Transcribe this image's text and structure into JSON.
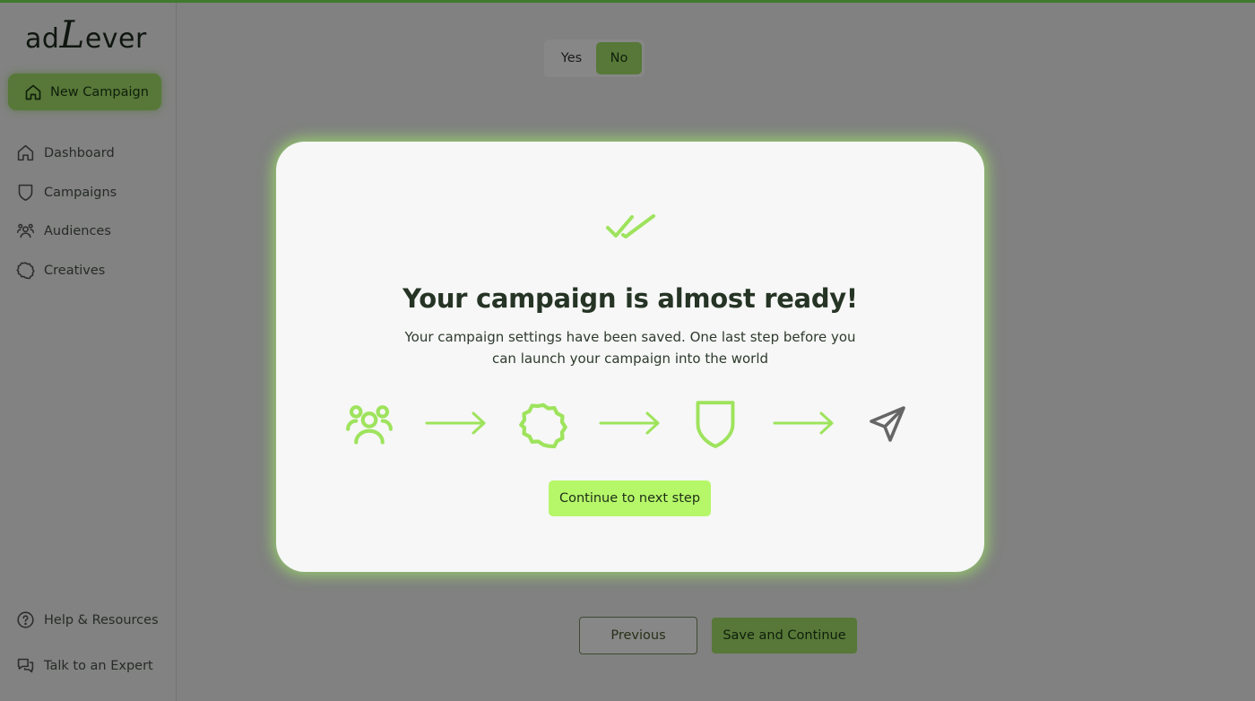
{
  "app": {
    "logo_prefix": "ad",
    "logo_letter": "L",
    "logo_suffix": "ever"
  },
  "sidebar": {
    "new_campaign_label": "New Campaign",
    "items": [
      {
        "label": "Dashboard",
        "icon": "home-icon"
      },
      {
        "label": "Campaigns",
        "icon": "shield-icon"
      },
      {
        "label": "Audiences",
        "icon": "users-icon"
      },
      {
        "label": "Creatives",
        "icon": "badge-icon"
      }
    ],
    "footer_items": [
      {
        "label": "Help & Resources",
        "icon": "help-circle-icon"
      },
      {
        "label": "Talk to an Expert",
        "icon": "chat-bubbles-icon"
      }
    ]
  },
  "main": {
    "yes_label": "Yes",
    "no_label": "No",
    "selected": "No",
    "previous_label": "Previous",
    "save_continue_label": "Save and Continue"
  },
  "modal": {
    "title": "Your campaign is almost ready!",
    "description": "Your campaign settings have been saved. One last step before you can launch your campaign into the world",
    "cta_label": "Continue to next step",
    "flow": [
      "users-icon",
      "badge-icon",
      "shield-icon",
      "send-icon"
    ]
  },
  "colors": {
    "accent": "#a5e26a",
    "accent_bright": "#b6f76a",
    "icon_green": "#9ee35c",
    "icon_gray": "#666666",
    "dark_green": "#3f7a2e"
  }
}
